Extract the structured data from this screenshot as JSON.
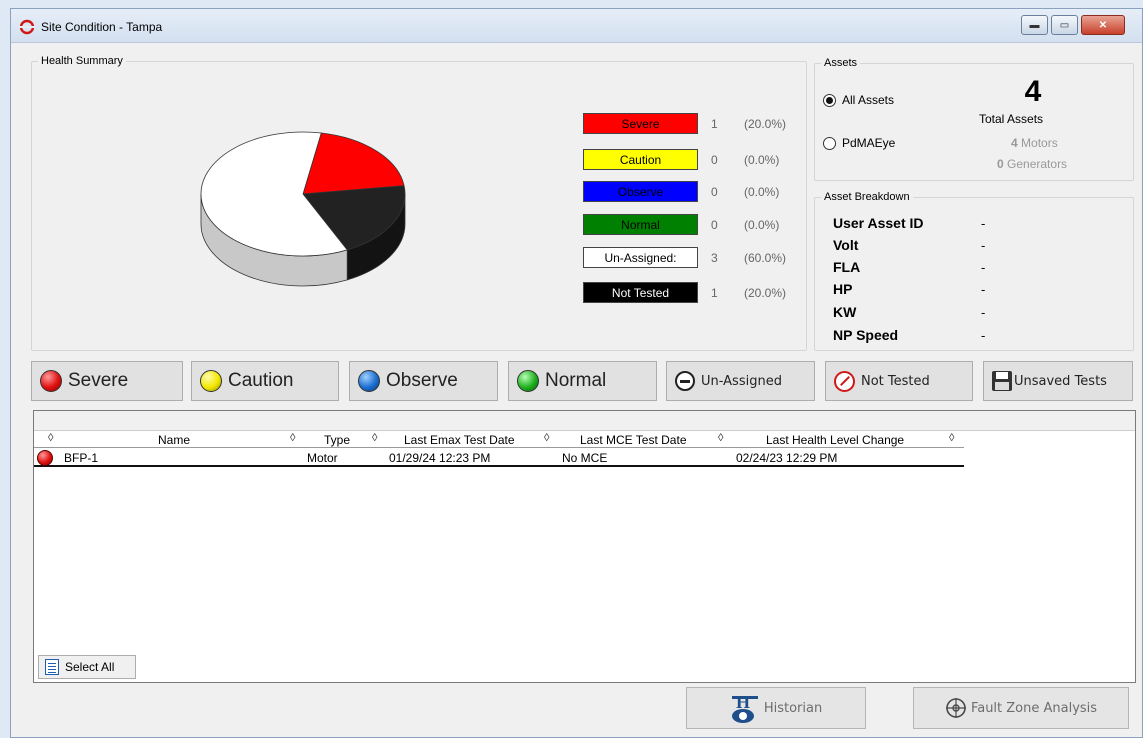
{
  "window": {
    "title": "Site Condition  - Tampa",
    "minimize_icon": "minimize-icon",
    "maximize_icon": "maximize-icon",
    "close_icon": "close-icon"
  },
  "health_summary": {
    "label": "Health Summary",
    "legend": [
      {
        "label": "Severe",
        "count": "1",
        "pct": "(20.0%)",
        "color": "#ff0000",
        "text_color": "#000000"
      },
      {
        "label": "Caution",
        "count": "0",
        "pct": "(0.0%)",
        "color": "#ffff00",
        "text_color": "#000000"
      },
      {
        "label": "Observe",
        "count": "0",
        "pct": "(0.0%)",
        "color": "#0000ff",
        "text_color": "#000000"
      },
      {
        "label": "Normal",
        "count": "0",
        "pct": "(0.0%)",
        "color": "#008000",
        "text_color": "#000000"
      },
      {
        "label": "Un-Assigned:",
        "count": "3",
        "pct": "(60.0%)",
        "color": "#ffffff",
        "text_color": "#000000"
      },
      {
        "label": "Not Tested",
        "count": "1",
        "pct": "(20.0%)",
        "color": "#000000",
        "text_color": "#ffffff"
      }
    ]
  },
  "chart_data": {
    "type": "pie",
    "title": "",
    "slices": [
      {
        "label": "Severe",
        "value": 1,
        "color": "#ff0000"
      },
      {
        "label": "Not Tested",
        "value": 1,
        "color": "#222222"
      },
      {
        "label": "Un-Assigned:",
        "value": 3,
        "color": "#ffffff"
      }
    ]
  },
  "assets": {
    "label": "Assets",
    "all_assets": "All Assets",
    "pdmaeye": "PdMAEye",
    "total": "4",
    "total_label": "Total Assets",
    "motors_count": "4",
    "motors_label": "Motors",
    "generators_count": "0",
    "generators_label": "Generators"
  },
  "breakdown": {
    "label": "Asset Breakdown",
    "rows": [
      {
        "key": "User Asset ID",
        "value": "-"
      },
      {
        "key": "Volt",
        "value": "-"
      },
      {
        "key": "FLA",
        "value": "-"
      },
      {
        "key": "HP",
        "value": "-"
      },
      {
        "key": "KW",
        "value": "-"
      },
      {
        "key": "NP Speed",
        "value": "-"
      }
    ]
  },
  "filters": {
    "severe": "Severe",
    "caution": "Caution",
    "observe": "Observe",
    "normal": "Normal",
    "unassigned": "Un-Assigned",
    "not_tested": "Not Tested",
    "unsaved": "Unsaved Tests",
    "colors": {
      "severe": "#e01010",
      "caution": "#f2e800",
      "observe": "#1c6fd0",
      "normal": "#20b020"
    }
  },
  "table": {
    "columns": [
      "Name",
      "Type",
      "Last Emax Test Date",
      "Last MCE Test Date",
      "Last Health Level Change"
    ],
    "rows": [
      {
        "name": "BFP-1",
        "type": "Motor",
        "emax": "01/29/24 12:23 PM",
        "mce": "No MCE",
        "health_change": "02/24/23 12:29 PM",
        "status_color": "#e01010"
      }
    ],
    "sort_glyph": "◊",
    "select_all": "Select All"
  },
  "bottom": {
    "historian": "Historian",
    "fault_zone": "Fault Zone Analysis"
  }
}
